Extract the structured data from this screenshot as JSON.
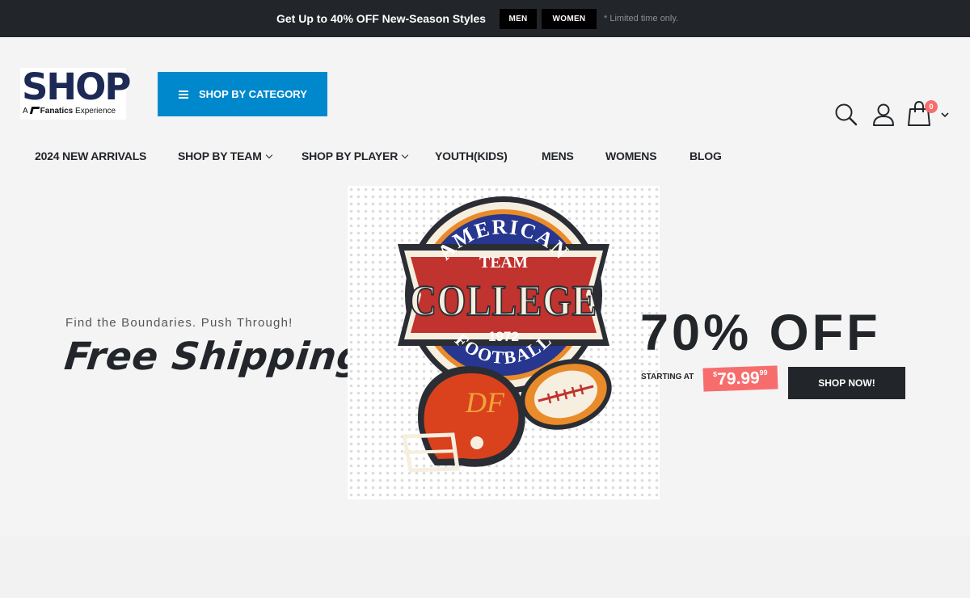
{
  "topbar": {
    "promo_prefix": "Get Up to ",
    "promo_highlight": "40% OFF",
    "promo_suffix": " New-Season Styles",
    "men_label": "MEN",
    "women_label": "WOMEN",
    "note": "* Limited time only."
  },
  "header": {
    "logo_text": "SHOP",
    "logo_sub_prefix": "A",
    "logo_sub_brand": "Fanatics",
    "logo_sub_suffix": "Experience",
    "category_button": "SHOP BY CATEGORY",
    "cart_count": "0",
    "icons": [
      "search-icon",
      "user-icon",
      "cart-icon",
      "chevron-down-icon"
    ]
  },
  "nav": {
    "items": [
      {
        "label": "2024 NEW ARRIVALS"
      },
      {
        "label": "SHOP BY TEAM"
      },
      {
        "label": "SHOP BY PLAYER"
      },
      {
        "label": "YOUTH(KIDS)"
      },
      {
        "label": "MENS"
      },
      {
        "label": "WOMENS"
      },
      {
        "label": "BLOG"
      }
    ]
  },
  "hero": {
    "tagline": "Find the Boundaries. Push Through!",
    "headline": "Free Shipping",
    "badge": {
      "top_text": "AMERICAN",
      "team": "TEAM",
      "main": "COLLEGE",
      "year": "1972",
      "bottom_text": "FOOTBALL",
      "helmet_mark": "DF"
    },
    "discount": "70% OFF",
    "starting_at": "STARTING AT",
    "price_currency": "$",
    "price": "79.99",
    "price_cents": "99",
    "cta": "SHOP NOW!"
  },
  "colors": {
    "accent": "#0088cc",
    "dark": "#222529",
    "sale": "#f76d6d",
    "background": "#f4f4f4"
  }
}
